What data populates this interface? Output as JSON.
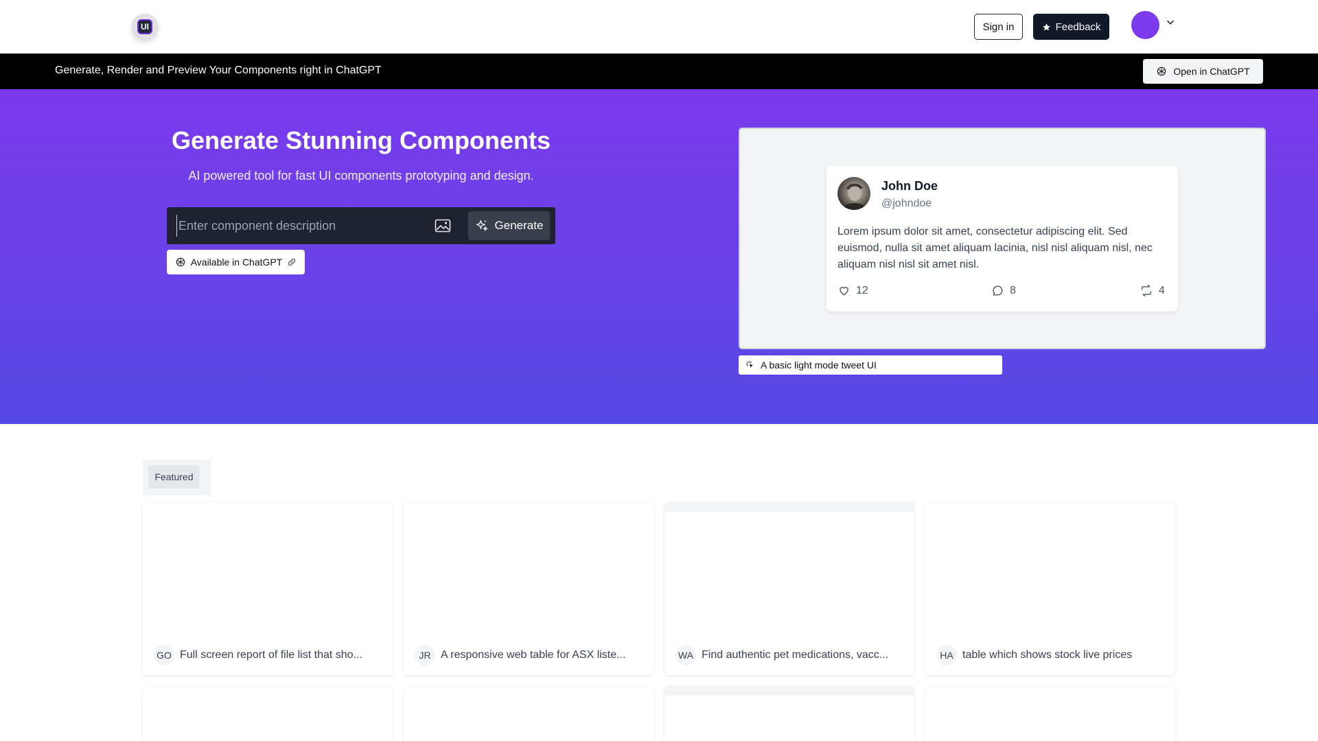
{
  "nav": {
    "logo_text": "UI",
    "signin_label": "Sign in",
    "feedback_label": "Feedback"
  },
  "banner": {
    "text": "Generate, Render and Preview Your Components right in ChatGPT",
    "open_label": "Open in ChatGPT"
  },
  "hero": {
    "title": "Generate Stunning Components",
    "subtitle": "AI powered tool for fast UI components prototyping and design.",
    "input_placeholder": "Enter component description",
    "generate_label": "Generate",
    "chatgpt_pill": "Available in ChatGPT"
  },
  "preview": {
    "tweet": {
      "name": "John Doe",
      "handle": "@johndoe",
      "body": "Lorem ipsum dolor sit amet, consectetur adipiscing elit. Sed euismod, nulla sit amet aliquam lacinia, nisl nisl aliquam nisl, nec aliquam nisl nisl sit amet nisl.",
      "likes": "12",
      "comments": "8",
      "retweets": "4"
    },
    "caption": "A basic light mode tweet UI"
  },
  "featured": {
    "tab_label": "Featured",
    "cards": [
      {
        "badge": "GO",
        "title": "Full screen report of file list that sho..."
      },
      {
        "badge": "JR",
        "title": "A responsive web table for ASX liste..."
      },
      {
        "badge": "WA",
        "title": "Find authentic pet medications, vacc..."
      },
      {
        "badge": "HA",
        "title": "table which shows stock live prices"
      }
    ]
  },
  "colors": {
    "hero_top": "#7b3aec",
    "hero_bottom": "#5547e3",
    "avatar": "#7c3aed",
    "banner": "#000000"
  }
}
